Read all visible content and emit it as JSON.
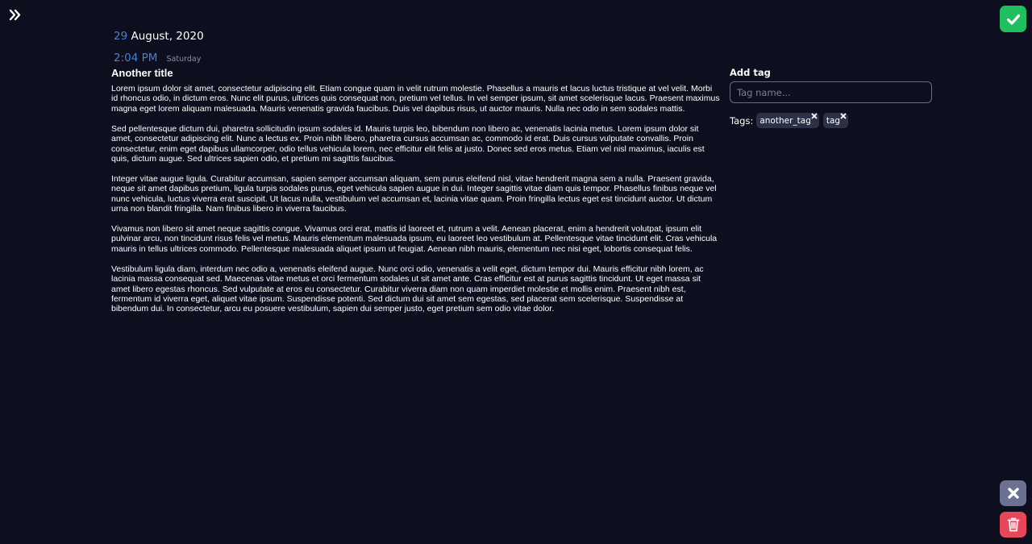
{
  "date": {
    "day": "29",
    "month_year": "August, 2020",
    "time": "2:04 PM",
    "weekday": "Saturday"
  },
  "note": {
    "title": "Another title",
    "paragraphs": [
      "Lorem ipsum dolor sit amet, consectetur adipiscing elit. Etiam congue quam in velit rutrum molestie. Phasellus a mauris et lacus luctus tristique at vel velit. Morbi id rhoncus odio, in dictum eros. Nunc elit purus, ultrices quis consequat non, pretium vel tellus. In vel semper ipsum, sit amet scelerisque lacus. Praesent maximus magna eget lorem aliquam malesuada. Mauris venenatis gravida faucibus. Duis vel dapibus risus, ut auctor mauris. Nulla nec odio in sem sodales mattis.",
      "Sed pellentesque dictum dui, pharetra sollicitudin ipsum sodales id. Mauris turpis leo, bibendum non libero ac, venenatis lacinia metus. Lorem ipsum dolor sit amet, consectetur adipiscing elit. Nunc a lectus ex. Proin nibh libero, pharetra cursus accumsan ac, commodo id erat. Duis cursus vulputate convallis. Proin consectetur, enim eget dapibus ullamcorper, odio tellus vehicula lorem, nec efficitur elit felis at justo. Donec sed eros metus. Etiam vel nisl maximus, iaculis est quis, dictum augue. Sed ultrices sapien odio, et pretium mi sagittis faucibus.",
      "Integer vitae augue ligula. Curabitur accumsan, sapien semper accumsan aliquam, sem purus eleifend nisl, vitae hendrerit magna sem a nulla. Praesent gravida, neque sit amet dapibus pretium, ligula turpis sodales purus, eget vehicula sapien augue in dui. Integer sagittis vitae diam quis tempor. Phasellus finibus neque vel nunc vehicula, luctus viverra erat suscipit. Ut lacus nulla, vestibulum vel accumsan et, lacinia vitae quam. Proin fringilla lectus eget est tincidunt auctor. Ut dictum urna non blandit fringilla. Nam finibus libero in viverra faucibus.",
      "Vivamus non libero sit amet neque sagittis congue. Vivamus orci erat, mattis id laoreet et, rutrum a velit. Aenean placerat, enim a hendrerit volutpat, ipsum elit pulvinar arcu, non tincidunt risus felis vel metus. Mauris elementum malesuada ipsum, eu laoreet leo vestibulum at. Pellentesque vitae tincidunt elit. Cras vehicula mauris in tellus ultrices commodo. Pellentesque malesuada aliquet ipsum ut feugiat. Aenean nibh mauris, elementum nec nisi eget, lobortis consequat felis.",
      "Vestibulum ligula diam, interdum nec odio a, venenatis eleifend augue. Nunc orci odio, venenatis a velit eget, dictum tempor dui. Mauris efficitur nibh lorem, ac lacinia massa consequat sed. Maecenas vitae metus et orci fermentum sodales ut sit amet ante. Cras efficitur est at purus sagittis tincidunt. Ut eget massa sit amet libero egestas rhoncus. Sed vulputate at eros eu consectetur. Curabitur viverra diam non quam imperdiet molestie et mollis enim. Praesent nibh est, fermentum id viverra eget, aliquet vitae ipsum. Suspendisse potenti. Sed dictum dui sit amet sem egestas, sed placerat sem scelerisque. Suspendisse at bibendum dui. In consectetur, arcu eu posuere vestibulum, sapien dui semper justo, eget pretium sem odio vitae dolor."
    ]
  },
  "tags_panel": {
    "add_label": "Add tag",
    "input_placeholder": "Tag name...",
    "input_value": "",
    "tags_label": "Tags:",
    "tags": [
      "another_tag",
      "tag"
    ]
  },
  "icons": {
    "expand": "double-chevron-right-icon",
    "save": "checkmark-icon",
    "cancel": "close-icon",
    "delete": "trash-icon",
    "remove_tag": "small-x-icon"
  },
  "colors": {
    "background": "#0d0f1e",
    "accent_blue": "#4a7fd6",
    "save_green": "#1fbf5f",
    "cancel_gray": "#6a7191",
    "delete_red": "#e8475a",
    "chip_bg": "#2c3147"
  }
}
